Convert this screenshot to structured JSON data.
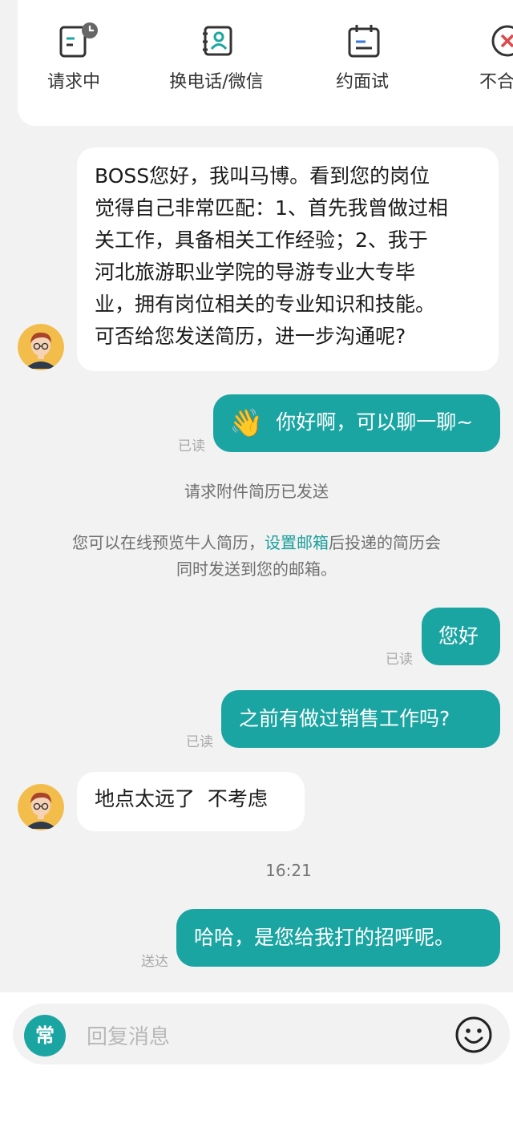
{
  "actions": [
    {
      "label": "请求中",
      "icon": "resume-pending-icon"
    },
    {
      "label": "换电话/微信",
      "icon": "contact-exchange-icon"
    },
    {
      "label": "约面试",
      "icon": "calendar-icon"
    },
    {
      "label": "不合",
      "icon": "reject-icon"
    }
  ],
  "colors": {
    "accent": "#1ba5a2",
    "read": "#a9a9a9",
    "background": "#f2f2f3"
  },
  "messages": {
    "m1": {
      "lines": [
        "BOSS您好，我叫马博。看到您的岗位",
        "觉得自己非常匹配：1、首先我曾做过相",
        "关工作，具备相关工作经验；2、我于",
        "河北旅游职业学院的导游专业大专毕",
        "业，拥有岗位相关的专业知识和技能。",
        "可否给您发送简历，进一步沟通呢?"
      ]
    },
    "m2": {
      "emoji": "👋",
      "text": "你好啊，可以聊一聊~",
      "status": "已读"
    },
    "sys1": "请求附件简历已发送",
    "sys2": {
      "pre": "您可以在线预览牛人简历，",
      "link": "设置邮箱",
      "post": "后投递的简历会",
      "line2": "同时发送到您的邮箱。"
    },
    "m3": {
      "text": "您好",
      "status": "已读"
    },
    "m4": {
      "text": "之前有做过销售工作吗?",
      "status": "已读"
    },
    "m5": {
      "text": "地点太远了  不考虑"
    },
    "time": "16:21",
    "m6": {
      "text": "哈哈，是您给我打的招呼呢。",
      "status": "送达"
    }
  },
  "input": {
    "quick_label": "常",
    "placeholder": "回复消息"
  }
}
